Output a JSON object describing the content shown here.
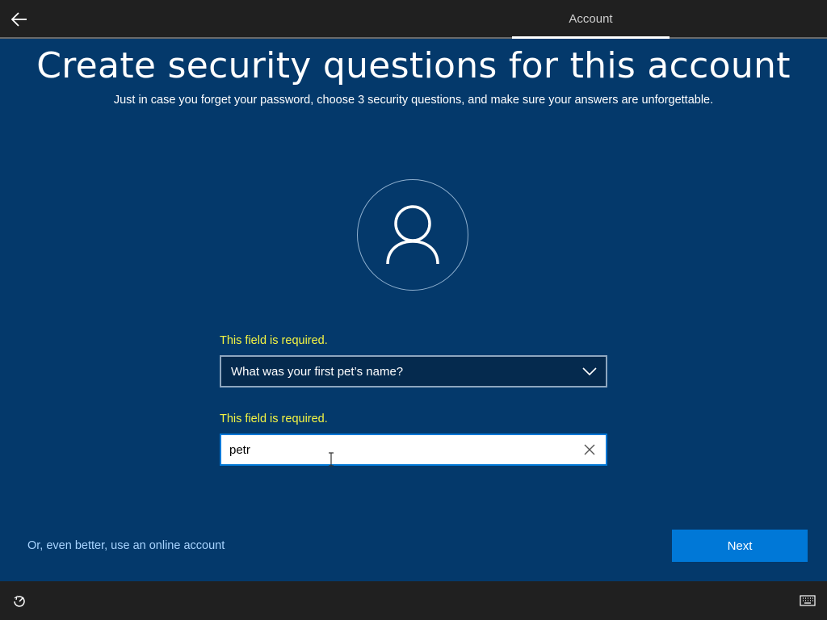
{
  "header": {
    "back_label": "Back",
    "active_tab": "Account"
  },
  "main": {
    "title": "Create security questions for this account",
    "subtitle": "Just in case you forget your password, choose 3 security questions, and make sure your answers are unforgettable.",
    "question_error": "This field is required.",
    "question_selected": "What was your first pet’s name?",
    "answer_error": "This field is required.",
    "answer_value": "petr"
  },
  "footer": {
    "online_account_link": "Or, even better, use an online account",
    "next_label": "Next"
  },
  "icons": {
    "back": "arrow-left-icon",
    "avatar": "user-icon",
    "chevron": "chevron-down-icon",
    "clear": "close-icon",
    "ease_of_access": "ease-of-access-icon",
    "keyboard": "keyboard-icon"
  },
  "colors": {
    "background": "#04396b",
    "bar": "#202020",
    "accent": "#0078d7",
    "error": "#f5f542",
    "link": "#a8d4ff"
  }
}
